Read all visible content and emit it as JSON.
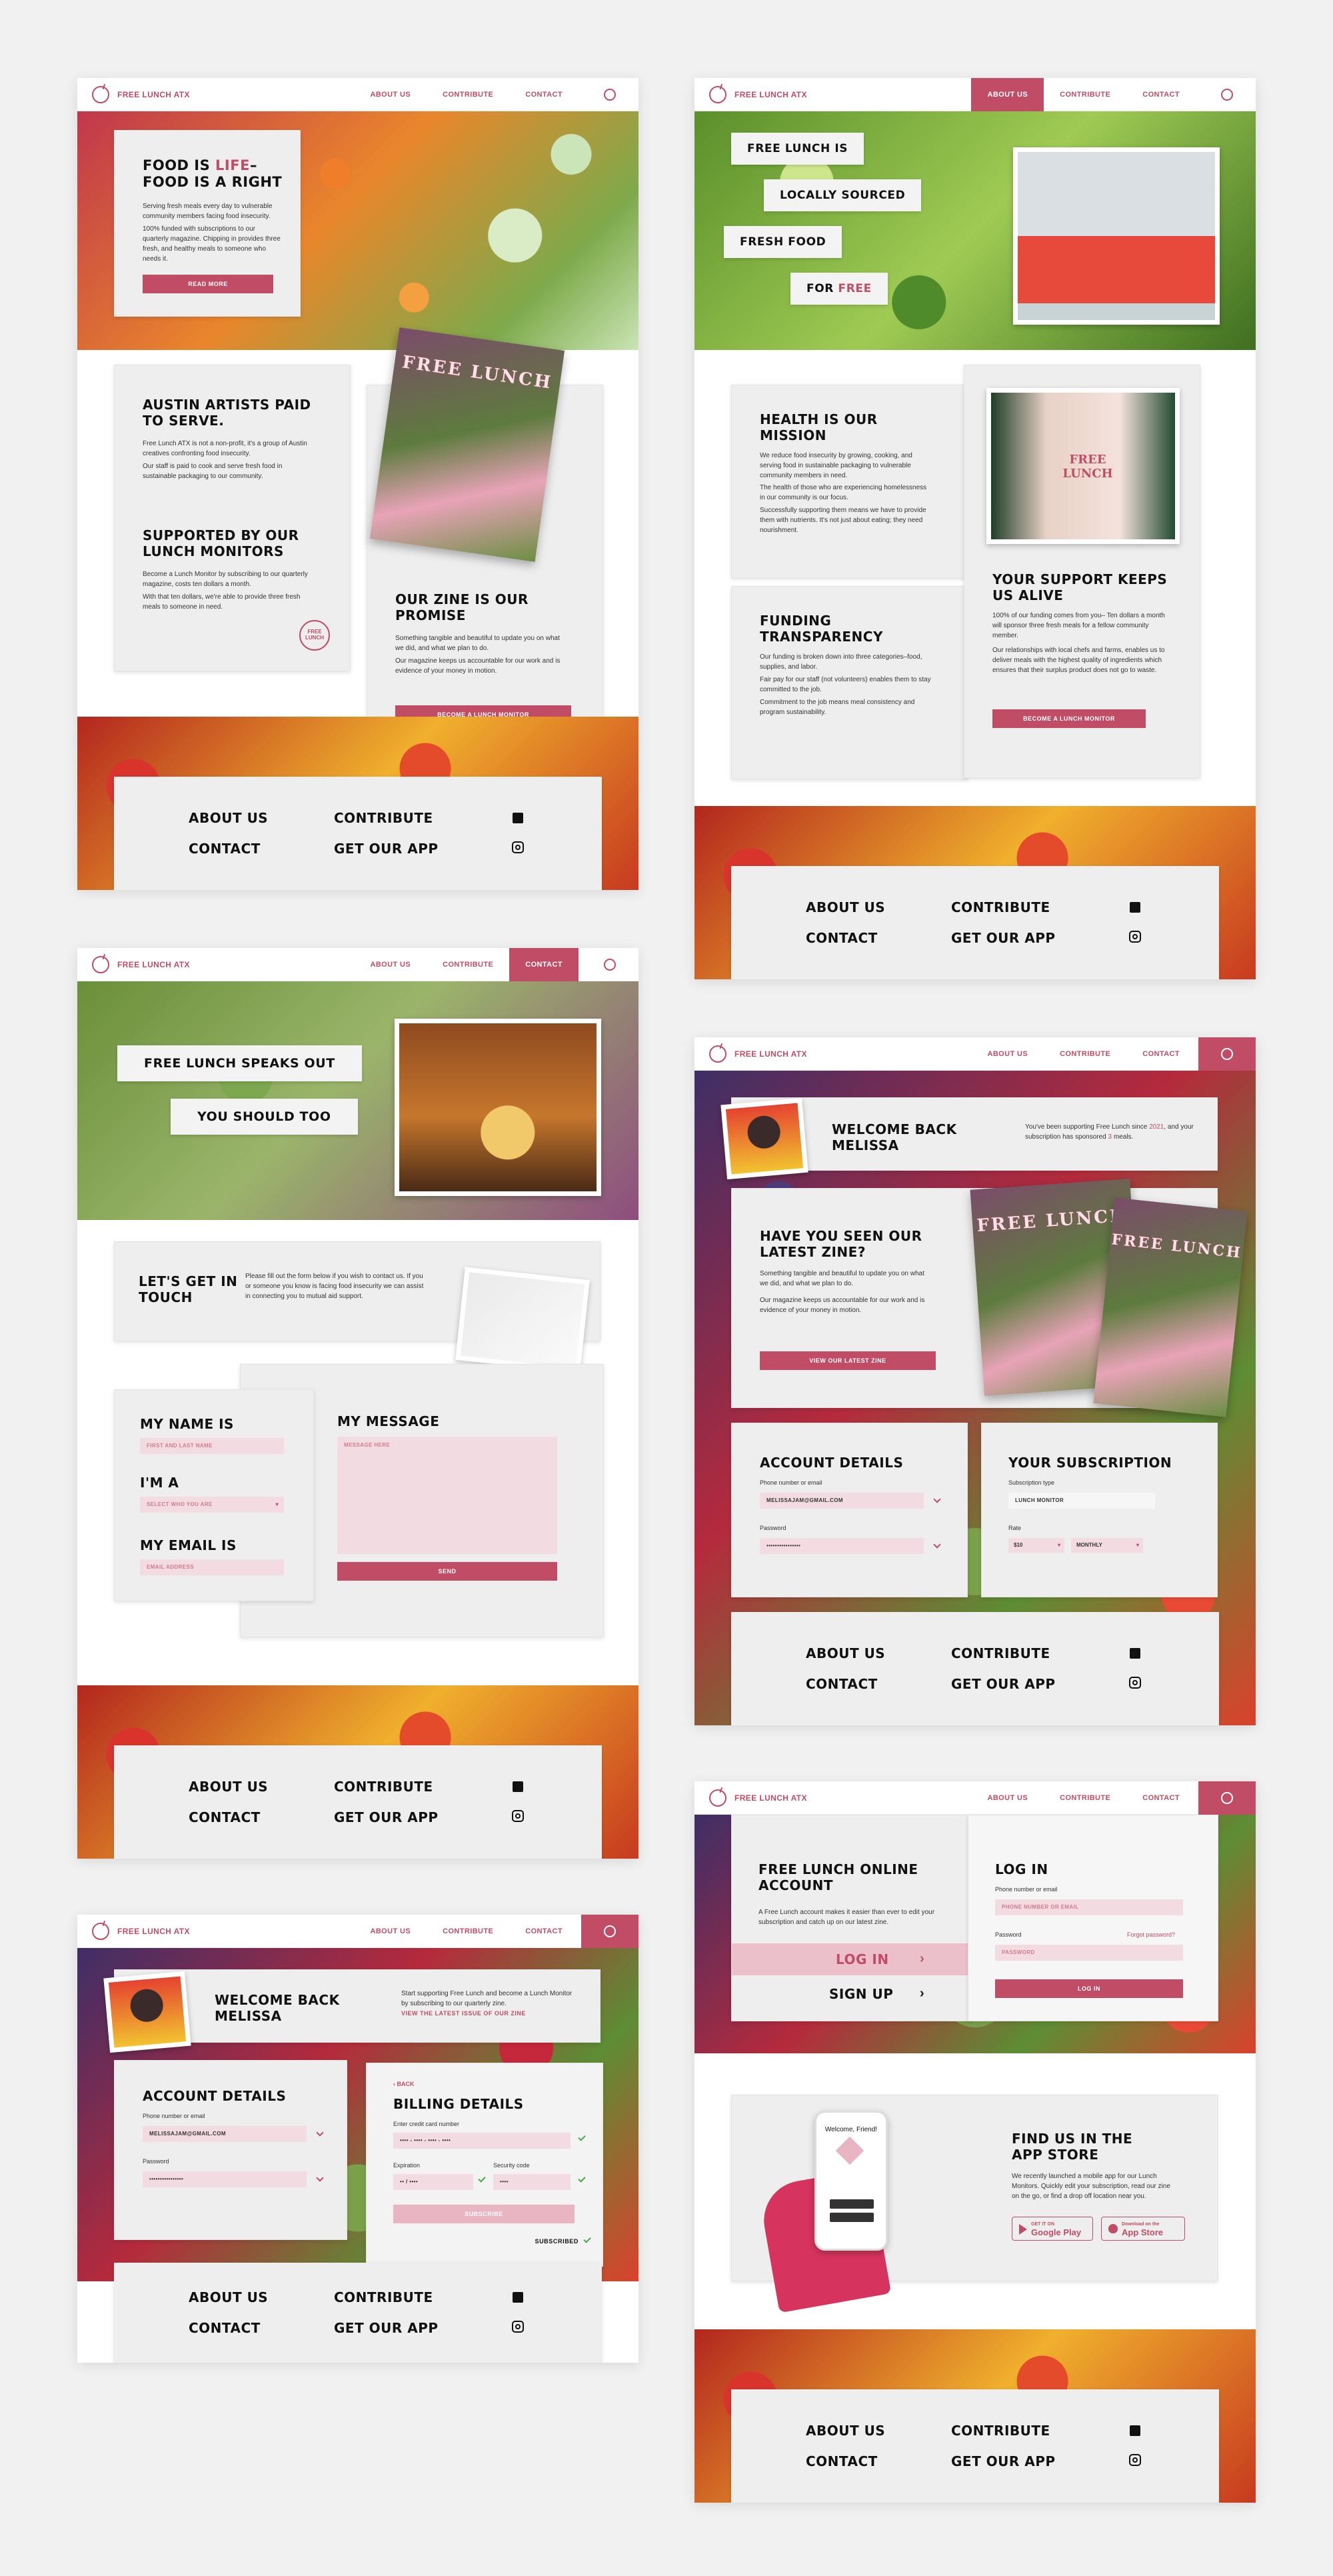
{
  "colors": {
    "accent": "#c04c65",
    "card": "#eeeeee",
    "bg": "#f1f1f1"
  },
  "nav": {
    "brand": "FREE LUNCH ATX",
    "about": "ABOUT US",
    "contribute": "CONTRIBUTE",
    "contact": "CONTACT",
    "user_icon": "user-icon",
    "logo_icon": "apple-icon"
  },
  "footer": {
    "about": "ABOUT US",
    "contribute": "CONTRIBUTE",
    "contact": "CONTACT",
    "app": "GET OUR APP",
    "facebook_icon": "facebook-icon",
    "instagram_icon": "instagram-icon"
  },
  "home": {
    "hero_title_1": "FOOD IS ",
    "hero_title_pink": "LIFE",
    "hero_title_2": "–",
    "hero_title_3": "FOOD IS A RIGHT",
    "hero_p1": "Serving fresh meals every day to vulnerable community members facing food insecurity.",
    "hero_p2": "100% funded with subscriptions to our quarterly magazine. Chipping in provides three fresh, and healthy meals to someone who needs it.",
    "read_more": "READ MORE",
    "artists_title": "AUSTIN ARTISTS PAID TO SERVE.",
    "artists_p1": "Free Lunch ATX is not a non-profit, it's a group of Austin creatives confronting food insecurity.",
    "artists_p2": "Our staff is paid to cook and serve fresh food in sustainable packaging to our community.",
    "monitors_title": "SUPPORTED BY OUR LUNCH MONITORS",
    "monitors_p1": "Become a Lunch Monitor by subscribing to our quarterly magazine, costs ten dollars a month.",
    "monitors_p2": "With that ten dollars, we're able to provide three fresh meals to someone in need.",
    "stamp": "FREE LUNCH",
    "zine_cover": "FREE LUNCH",
    "zine_title": "OUR ZINE IS OUR PROMISE",
    "zine_p1": "Something tangible and beautiful to update you on what we did, and what we plan to do.",
    "zine_p2": "Our magazine keeps us accountable for our work and is evidence of your money in motion.",
    "become": "BECOME A LUNCH MONITOR"
  },
  "about": {
    "tag1": "FREE LUNCH IS",
    "tag2": "LOCALLY SOURCED",
    "tag3": "FRESH FOOD",
    "tag4a": "FOR ",
    "tag4b": "FREE",
    "mission_title": "HEALTH IS OUR MISSION",
    "mission_p1": "We reduce food insecurity by growing, cooking, and serving food in sustainable packaging to vulnerable community members in need.",
    "mission_p2": "The health of those who are experiencing homelessness in our community is our focus.",
    "mission_p3": "Successfully supporting them means we have to provide them with nutrients. It's not just about eating; they need nourishment.",
    "shirt_text": "FREE LUNCH",
    "funding_title": "FUNDING TRANSPARENCY",
    "funding_p1": "Our funding is broken down into three categories–food, supplies, and labor.",
    "funding_p2": "Fair pay for our staff (not volunteers) enables them to stay committed to the job.",
    "funding_p3": "Commitment to the job means meal consistency and program sustainability.",
    "support_title": "YOUR SUPPORT KEEPS US ALIVE",
    "support_p1": "100% of our funding comes from you– Ten dollars a month will sponsor three fresh meals for a fellow community member.",
    "support_p2": "Our relationships with local chefs and farms, enables us to deliver meals with the highest quality of ingredients which ensures that their surplus product does not go to waste.",
    "become": "BECOME A LUNCH MONITOR"
  },
  "contact": {
    "tag1": "FREE LUNCH SPEAKS OUT",
    "tag2": "YOU SHOULD TOO",
    "touch_title": "LET'S GET IN TOUCH",
    "touch_p": "Please fill out the form below if you wish to contact us. If you or someone you know is facing food insecurity we can assist in connecting you to mutual aid support.",
    "name_label": "MY NAME IS",
    "name_placeholder": "FIRST AND LAST NAME",
    "im_label": "I'M A",
    "im_placeholder": "SELECT WHO YOU ARE",
    "email_label": "MY EMAIL IS",
    "email_placeholder": "EMAIL ADDRESS",
    "message_label": "MY MESSAGE",
    "message_placeholder": "MESSAGE HERE",
    "send": "SEND"
  },
  "billing": {
    "welcome": "WELCOME BACK MELISSA",
    "welcome_p": "Start supporting Free Lunch and become a Lunch Monitor by subscribing to our quarterly zine.",
    "welcome_link": "VIEW THE LATEST ISSUE OF OUR ZINE",
    "account_title": "ACCOUNT DETAILS",
    "phone_label": "Phone number or email",
    "phone_value": "MELISSAJAM@GMAIL.COM",
    "password_label": "Password",
    "password_value": "••••••••••••••••",
    "back": "BACK",
    "billing_title": "BILLING DETAILS",
    "card_label": "Enter credit card number",
    "card_value": "•••• - •••• - •••• - ••••",
    "exp_label": "Expiration",
    "exp_value": "•• / ••••",
    "code_label": "Security code",
    "code_value": "••••",
    "submit": "SUBSCRIBE",
    "subscribed": "SUBSCRIBED"
  },
  "dashboard": {
    "welcome": "WELCOME BACK MELISSA",
    "since_1": "You've been supporting Free Lunch since ",
    "since_year": "2021",
    "since_2": ", and your subscription has sponsored ",
    "since_count": "3",
    "since_3": " meals.",
    "zine_title": "HAVE YOU SEEN OUR LATEST ZINE?",
    "zine_p1": "Something tangible and beautiful to update you on what we did, and what we plan to do.",
    "zine_p2": "Our magazine keeps us accountable for our work and is evidence of your money in motion.",
    "zine_btn": "VIEW OUR LATEST ZINE",
    "zine_cover": "FREE LUNCH",
    "account_title": "ACCOUNT DETAILS",
    "phone_label": "Phone number or email",
    "phone_value": "MELISSAJAM@GMAIL.COM",
    "password_label": "Password",
    "password_value": "••••••••••••••••",
    "sub_title": "YOUR SUBSCRIPTION",
    "type_label": "Subscription type",
    "type_value": "LUNCH MONITOR",
    "rate_label": "Rate",
    "rate_value": "$10",
    "rate_period": "MONTHLY"
  },
  "login": {
    "online_title": "FREE LUNCH ONLINE ACCOUNT",
    "online_p": "A Free Lunch account makes it easier than ever to edit your subscription and catch up on our latest zine.",
    "login_tab": "LOG IN",
    "signup_tab": "SIGN UP",
    "login_title": "LOG IN",
    "phone_label": "Phone number or email",
    "phone_placeholder": "PHONE NUMBER OR EMAIL",
    "password_label": "Password",
    "forgot": "Forgot password?",
    "password_placeholder": "PASSWORD",
    "login_btn": "LOG IN",
    "app_title": "FIND US IN THE APP STORE",
    "app_p": "We recently launched a mobile app for our Lunch Monitors. Quickly edit your subscription, read our zine on the go, or find a drop off location near you.",
    "phone_welcome": "Welcome, Friend!",
    "google_small": "GET IT ON",
    "google": "Google Play",
    "apple_small": "Download on the",
    "apple": "App Store"
  }
}
